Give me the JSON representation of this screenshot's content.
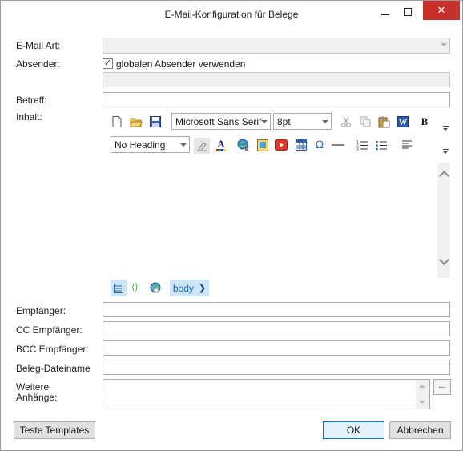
{
  "window": {
    "title": "E-Mail-Konfiguration für Belege",
    "close_glyph": "✕"
  },
  "form": {
    "email_art_label": "E-Mail Art:",
    "absender_label": "Absender:",
    "global_sender_checkbox_label": "globalen Absender verwenden",
    "global_sender_checked": true,
    "betreff_label": "Betreff:",
    "inhalt_label": "Inhalt:",
    "empfaenger_label": "Empfänger:",
    "cc_label": "CC Empfänger:",
    "bcc_label": "BCC Empfänger:",
    "beleg_dateiname_label": "Beleg-Dateiname",
    "weitere_label_line1": "Weitere",
    "weitere_label_line2": "Anhänge:",
    "ellipsis_label": "..."
  },
  "editor": {
    "font_family": "Microsoft Sans Serif",
    "font_size": "8pt",
    "paragraph_style": "No Heading",
    "bold_label": "B",
    "body_tag": "body",
    "toolbar_row1_icons": [
      "new-document-icon",
      "open-folder-icon",
      "save-icon",
      "cut-icon",
      "copy-icon",
      "paste-icon",
      "paste-word-icon",
      "bold-icon"
    ],
    "toolbar_row2_icons": [
      "highlight-icon",
      "font-color-icon",
      "link-icon",
      "image-icon",
      "video-icon",
      "table-icon",
      "omega-icon",
      "horizontal-rule-icon",
      "ordered-list-icon",
      "unordered-list-icon",
      "align-icon"
    ]
  },
  "buttons": {
    "test_templates": "Teste Templates",
    "ok": "OK",
    "cancel": "Abbrechen"
  },
  "colors": {
    "close_red": "#c8312b",
    "accent_blue": "#0078d7",
    "tag_bg": "#cde6f7"
  }
}
